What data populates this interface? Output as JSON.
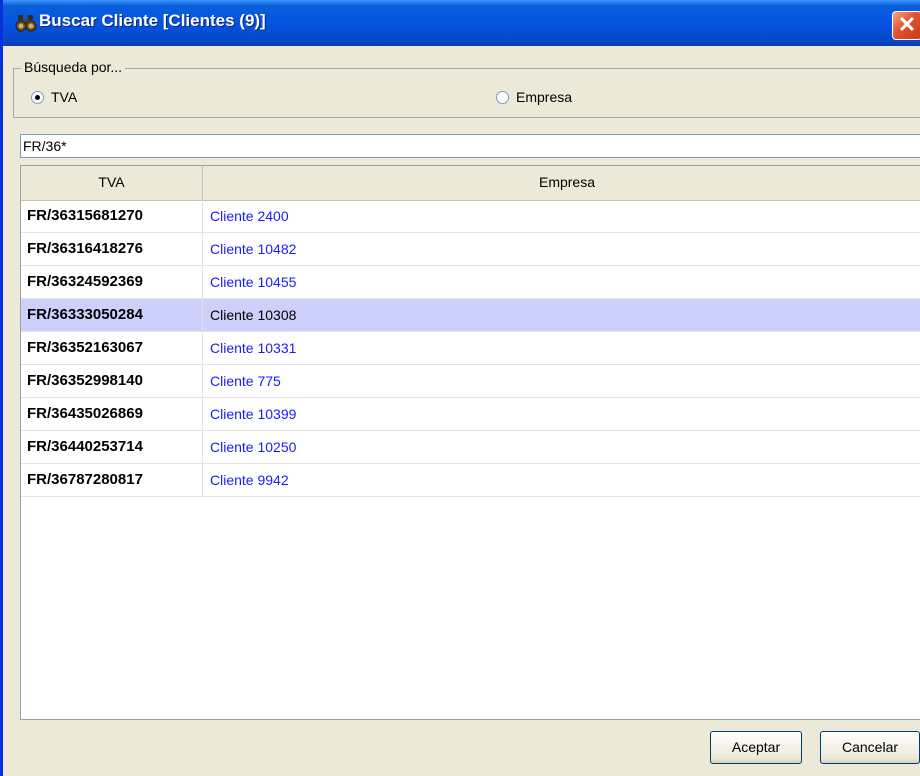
{
  "window": {
    "title": "Buscar Cliente [Clientes (9)]",
    "close_glyph": "✕",
    "title_icon": "binoculars-icon"
  },
  "search_by": {
    "legend": "Búsqueda por...",
    "options": [
      {
        "label": "TVA",
        "selected": true
      },
      {
        "label": "Empresa",
        "selected": false
      }
    ]
  },
  "search": {
    "value": "FR/36*"
  },
  "grid": {
    "columns": [
      "TVA",
      "Empresa"
    ],
    "selected_index": 3,
    "rows": [
      {
        "tva": "FR/36315681270",
        "empresa": "Cliente 2400"
      },
      {
        "tva": "FR/36316418276",
        "empresa": "Cliente 10482"
      },
      {
        "tva": "FR/36324592369",
        "empresa": "Cliente 10455"
      },
      {
        "tva": "FR/36333050284",
        "empresa": "Cliente 10308"
      },
      {
        "tva": "FR/36352163067",
        "empresa": "Cliente 10331"
      },
      {
        "tva": "FR/36352998140",
        "empresa": "Cliente 775"
      },
      {
        "tva": "FR/36435026869",
        "empresa": "Cliente 10399"
      },
      {
        "tva": "FR/36440253714",
        "empresa": "Cliente 10250"
      },
      {
        "tva": "FR/36787280817",
        "empresa": "Cliente 9942"
      }
    ]
  },
  "buttons": {
    "accept": "Aceptar",
    "cancel": "Cancelar"
  },
  "colors": {
    "titlebar": "#0554e3",
    "link_text": "#1a1aff",
    "selected_row": "#cdd0fa",
    "dialog_bg": "#ece9d8"
  }
}
